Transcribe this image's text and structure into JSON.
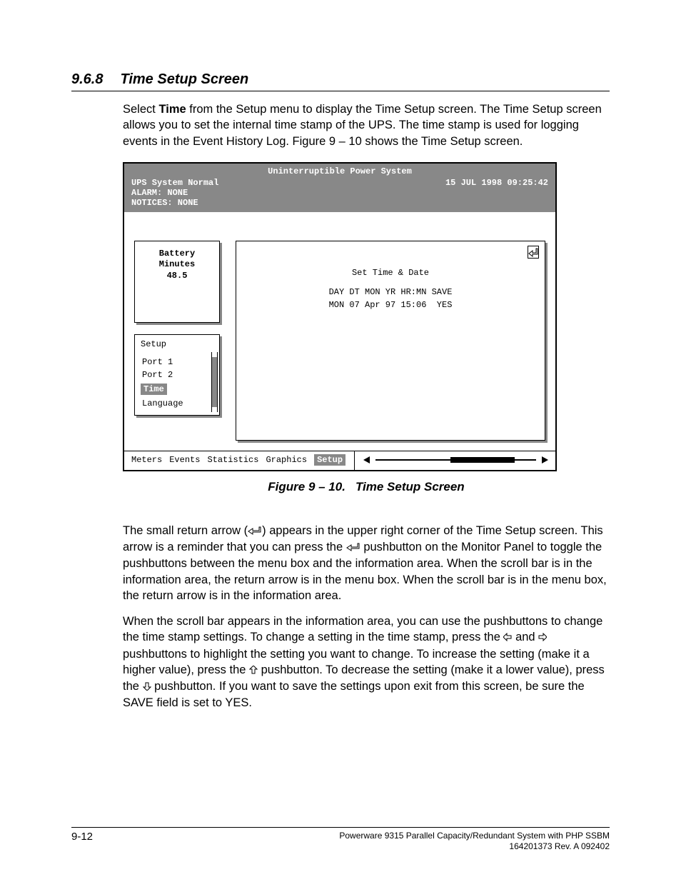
{
  "heading": {
    "number": "9.6.8",
    "title": "Time Setup Screen"
  },
  "intro": {
    "p1_a": "Select ",
    "p1_bold": "Time",
    "p1_b": " from the Setup menu to display the Time Setup screen.  The Time Setup screen allows you to set the internal time stamp of the UPS.  The time stamp is used for logging events in the Event History Log.  Figure 9 – 10 shows the Time Setup screen."
  },
  "crt": {
    "title": "Uninterruptible Power System",
    "status": "UPS System Normal",
    "datetime": "15 JUL 1998  09:25:42",
    "alarm": "ALARM:  NONE",
    "notices": "NOTICES: NONE",
    "battery": {
      "l1": "Battery",
      "l2": "Minutes",
      "l3": "48.5"
    },
    "setup_menu": {
      "title": "Setup",
      "items": [
        "Port 1",
        "Port 2",
        "Time",
        "Language"
      ],
      "selected_index": 2
    },
    "info": {
      "title": "Set Time & Date",
      "header": "DAY DT MON YR HR:MN SAVE",
      "values": "MON 07 Apr 97 15:06  YES"
    },
    "menubar": {
      "items": [
        "Meters",
        "Events",
        "Statistics",
        "Graphics",
        "Setup"
      ],
      "selected_index": 4
    }
  },
  "caption": {
    "fig": "Figure 9 – 10.",
    "title": "Time Setup Screen"
  },
  "para2": {
    "a": "The small return arrow (",
    "b": ") appears in the upper right corner of the Time Setup screen.  This arrow is a reminder that you can press the ",
    "c": " pushbutton on the Monitor Panel to toggle the pushbuttons between the menu box and the information area.  When the scroll bar is in the information area, the return arrow is in the menu box.  When the scroll bar is in the menu box, the return arrow is in the information area."
  },
  "para3": {
    "a": "When the scroll bar appears in the information area, you can use the pushbuttons to change the time stamp settings.  To change a setting in the time stamp, press the ",
    "b": " and ",
    "c": " pushbuttons to highlight the setting you want to change.  To increase the setting (make it a higher value), press the ",
    "d": " pushbutton.  To decrease the setting (make it a lower value), press the ",
    "e": " pushbutton.  If you want to save the settings upon exit from this screen, be sure the SAVE field is set to YES."
  },
  "footer": {
    "page": "9-12",
    "line1": "Powerware 9315 Parallel Capacity/Redundant System with PHP SSBM",
    "line2": "164201373   Rev. A      092402"
  }
}
